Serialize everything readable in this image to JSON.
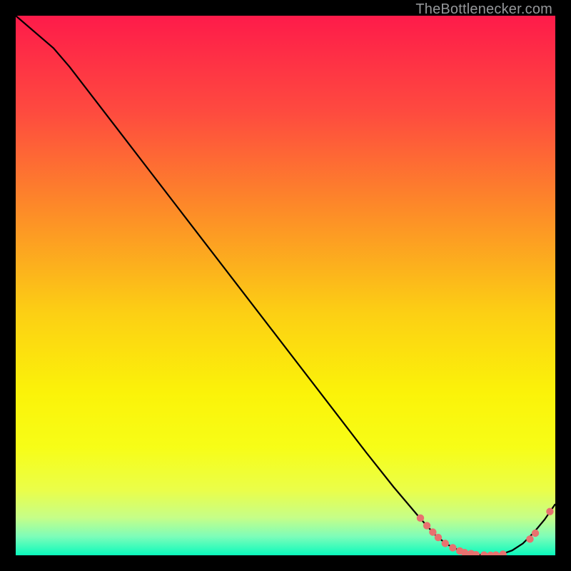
{
  "watermark": "TheBottlenecker.com",
  "chart_data": {
    "type": "line",
    "title": "",
    "xlabel": "",
    "ylabel": "",
    "xlim": [
      0,
      100
    ],
    "ylim": [
      0,
      100
    ],
    "grid": false,
    "series": [
      {
        "name": "curve",
        "x": [
          0,
          7,
          10,
          15,
          20,
          25,
          30,
          35,
          40,
          45,
          50,
          55,
          60,
          65,
          70,
          75,
          78,
          80,
          82,
          84,
          86,
          88,
          90,
          92,
          94,
          96,
          98,
          100
        ],
        "y": [
          100,
          94,
          90.5,
          84,
          77.5,
          71,
          64.5,
          58,
          51.5,
          45,
          38.5,
          32,
          25.5,
          19,
          12.7,
          6.8,
          3.5,
          2.0,
          1.0,
          0.4,
          0.1,
          0.0,
          0.2,
          0.9,
          2.2,
          4.2,
          6.6,
          9.5
        ]
      }
    ],
    "markers": {
      "name": "highlight-points",
      "color": "#e8716f",
      "x": [
        75.0,
        76.2,
        77.3,
        78.3,
        79.6,
        81.0,
        82.3,
        83.2,
        84.4,
        85.3,
        86.8,
        88.0,
        89.0,
        90.3,
        95.3,
        96.3,
        99.0
      ],
      "y": [
        6.9,
        5.5,
        4.3,
        3.3,
        2.2,
        1.4,
        0.8,
        0.5,
        0.3,
        0.1,
        0.05,
        0.0,
        0.05,
        0.2,
        3.0,
        4.1,
        8.1
      ]
    },
    "background_gradient": {
      "stops": [
        {
          "offset": 0.0,
          "color": "#fe1b4a"
        },
        {
          "offset": 0.18,
          "color": "#fe4b3f"
        },
        {
          "offset": 0.36,
          "color": "#fd8b28"
        },
        {
          "offset": 0.55,
          "color": "#fccf14"
        },
        {
          "offset": 0.7,
          "color": "#fbf309"
        },
        {
          "offset": 0.8,
          "color": "#f7fd17"
        },
        {
          "offset": 0.88,
          "color": "#eafe4a"
        },
        {
          "offset": 0.93,
          "color": "#c6fe88"
        },
        {
          "offset": 0.965,
          "color": "#7efdb9"
        },
        {
          "offset": 1.0,
          "color": "#0afabc"
        }
      ]
    }
  }
}
